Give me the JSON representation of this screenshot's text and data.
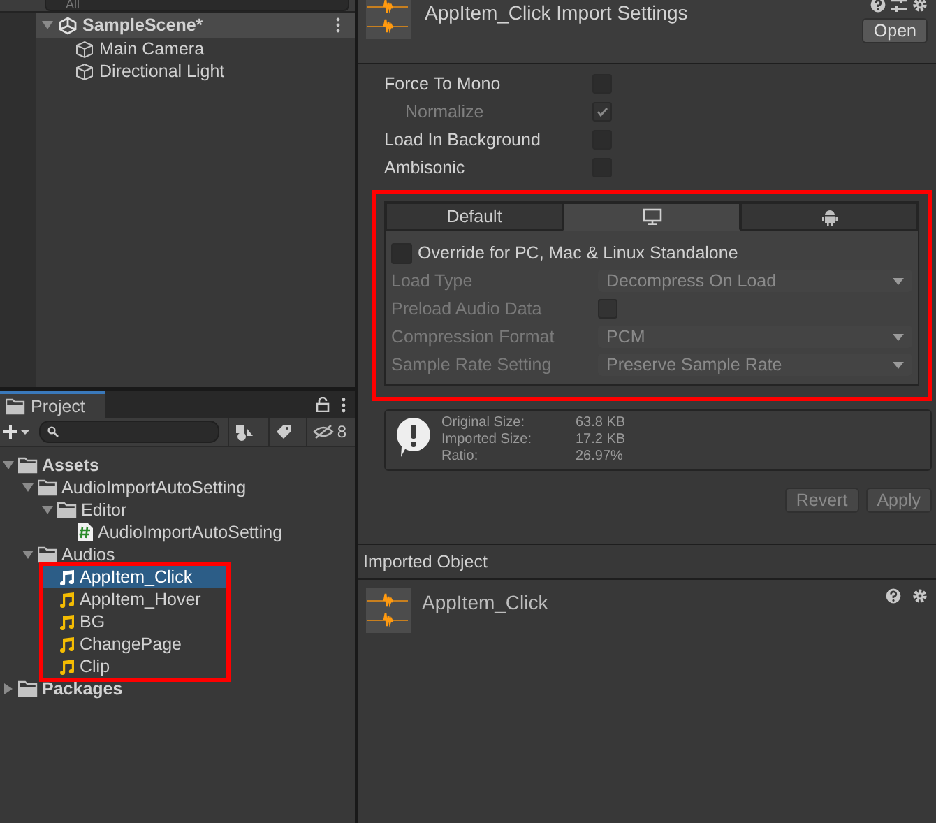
{
  "hierarchy": {
    "search_placeholder": "All",
    "scene": {
      "name": "SampleScene*",
      "expanded": true
    },
    "objects": [
      {
        "name": "Main Camera"
      },
      {
        "name": "Directional Light"
      }
    ]
  },
  "project": {
    "tab": "Project",
    "hidden_count": "8",
    "tree": [
      {
        "name": "Assets",
        "kind": "folder",
        "expanded": true,
        "selected": false,
        "children": [
          {
            "name": "AudioImportAutoSetting",
            "kind": "folder",
            "expanded": true,
            "selected": false,
            "children": [
              {
                "name": "Editor",
                "kind": "folder",
                "expanded": true,
                "selected": false,
                "children": [
                  {
                    "name": "AudioImportAutoSetting",
                    "kind": "script",
                    "selected": false
                  }
                ]
              }
            ]
          },
          {
            "name": "Audios",
            "kind": "folder",
            "expanded": true,
            "selected": false,
            "highlighted": true,
            "children": [
              {
                "name": "AppItem_Click",
                "kind": "audio",
                "selected": true
              },
              {
                "name": "AppItem_Hover",
                "kind": "audio",
                "selected": false
              },
              {
                "name": "BG",
                "kind": "audio",
                "selected": false
              },
              {
                "name": "ChangePage",
                "kind": "audio",
                "selected": false
              },
              {
                "name": "Clip",
                "kind": "audio",
                "selected": false
              }
            ]
          }
        ]
      },
      {
        "name": "Packages",
        "kind": "folder",
        "expanded": false,
        "selected": false
      }
    ]
  },
  "inspector": {
    "title": "AppItem_Click Import Settings",
    "open_button": "Open",
    "options": [
      {
        "label": "Force To Mono",
        "checked": false,
        "disabled": false
      },
      {
        "label": "Normalize",
        "checked": true,
        "disabled": true
      },
      {
        "label": "Load In Background",
        "checked": false,
        "disabled": false
      },
      {
        "label": "Ambisonic",
        "checked": false,
        "disabled": false
      }
    ],
    "platform_tabs": [
      {
        "kind": "text",
        "label": "Default",
        "selected": false
      },
      {
        "kind": "monitor",
        "selected": true
      },
      {
        "kind": "android",
        "selected": false
      }
    ],
    "override": {
      "label": "Override for PC, Mac & Linux Standalone",
      "checked": false
    },
    "settings": [
      {
        "kind": "dropdown",
        "label": "Load Type",
        "value": "Decompress On Load",
        "disabled": true
      },
      {
        "kind": "checkbox",
        "label": "Preload Audio Data",
        "checked": false,
        "disabled": true
      },
      {
        "kind": "dropdown",
        "label": "Compression Format",
        "value": "PCM",
        "disabled": true
      },
      {
        "kind": "dropdown",
        "label": "Sample Rate Setting",
        "value": "Preserve Sample Rate",
        "disabled": true
      }
    ],
    "info": [
      {
        "label": "Original Size:",
        "value": "63.8 KB"
      },
      {
        "label": "Imported Size:",
        "value": "17.2 KB"
      },
      {
        "label": "Ratio:",
        "value": "26.97%"
      }
    ],
    "buttons": [
      {
        "label": "Revert",
        "disabled": true
      },
      {
        "label": "Apply",
        "disabled": true
      }
    ],
    "imported_object": {
      "header": "Imported Object",
      "name": "AppItem_Click"
    }
  }
}
